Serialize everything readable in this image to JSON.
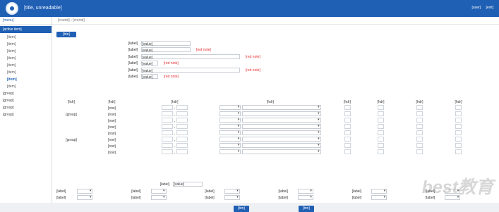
{
  "app": {
    "title": "[title, unreadable]",
    "user": [
      "[user]",
      "[exit]"
    ]
  },
  "sidebar": {
    "head": "[menu]",
    "active": "[active item]",
    "items": [
      "[item]",
      "[item]",
      "[item]",
      "[item]",
      "[item]",
      "[item]",
      "[item]",
      "[item]"
    ],
    "groups": [
      "[group]",
      "[group]",
      "[group]",
      "[group]"
    ]
  },
  "breadcrumb": [
    "[crumb]",
    "[crumb]"
  ],
  "main": {
    "info_button": "[btn]",
    "fields": [
      {
        "label": "[label]",
        "value": "[value]",
        "hint": ""
      },
      {
        "label": "[label]",
        "value": "[value]",
        "hint": "[red note]"
      },
      {
        "label": "[label]",
        "value": "[value]",
        "hint": "[red note]"
      },
      {
        "label": "[label]",
        "value": "[value]",
        "hint": "[red note]"
      },
      {
        "label": "[label]",
        "value": "[value]",
        "hint": "[red note]"
      },
      {
        "label": "[label]",
        "value": "[value]",
        "hint": "[red note]"
      }
    ],
    "table_headers": [
      "[hdr]",
      "[hdr]",
      "[hdr]",
      "[hdr]",
      "[hdr]",
      "[hdr]",
      "[hdr]",
      "[hdr]"
    ],
    "row_groups": [
      "[group]",
      "[group]"
    ],
    "rows": [
      "[row]",
      "[row]",
      "[row]",
      "[row]",
      "[row]",
      "[row]",
      "[row]",
      "[row]"
    ],
    "input_label": "[label]",
    "code_value": "[value]",
    "bottom_labels": [
      "[label]",
      "[label]",
      "[label]",
      "[label]",
      "[label]",
      "[label]",
      "[label]",
      "[label]",
      "[label]",
      "[label]",
      "[label]",
      "[label]"
    ],
    "next_buttons": [
      "[btn]",
      "[btn]"
    ]
  },
  "watermark": "best教育"
}
